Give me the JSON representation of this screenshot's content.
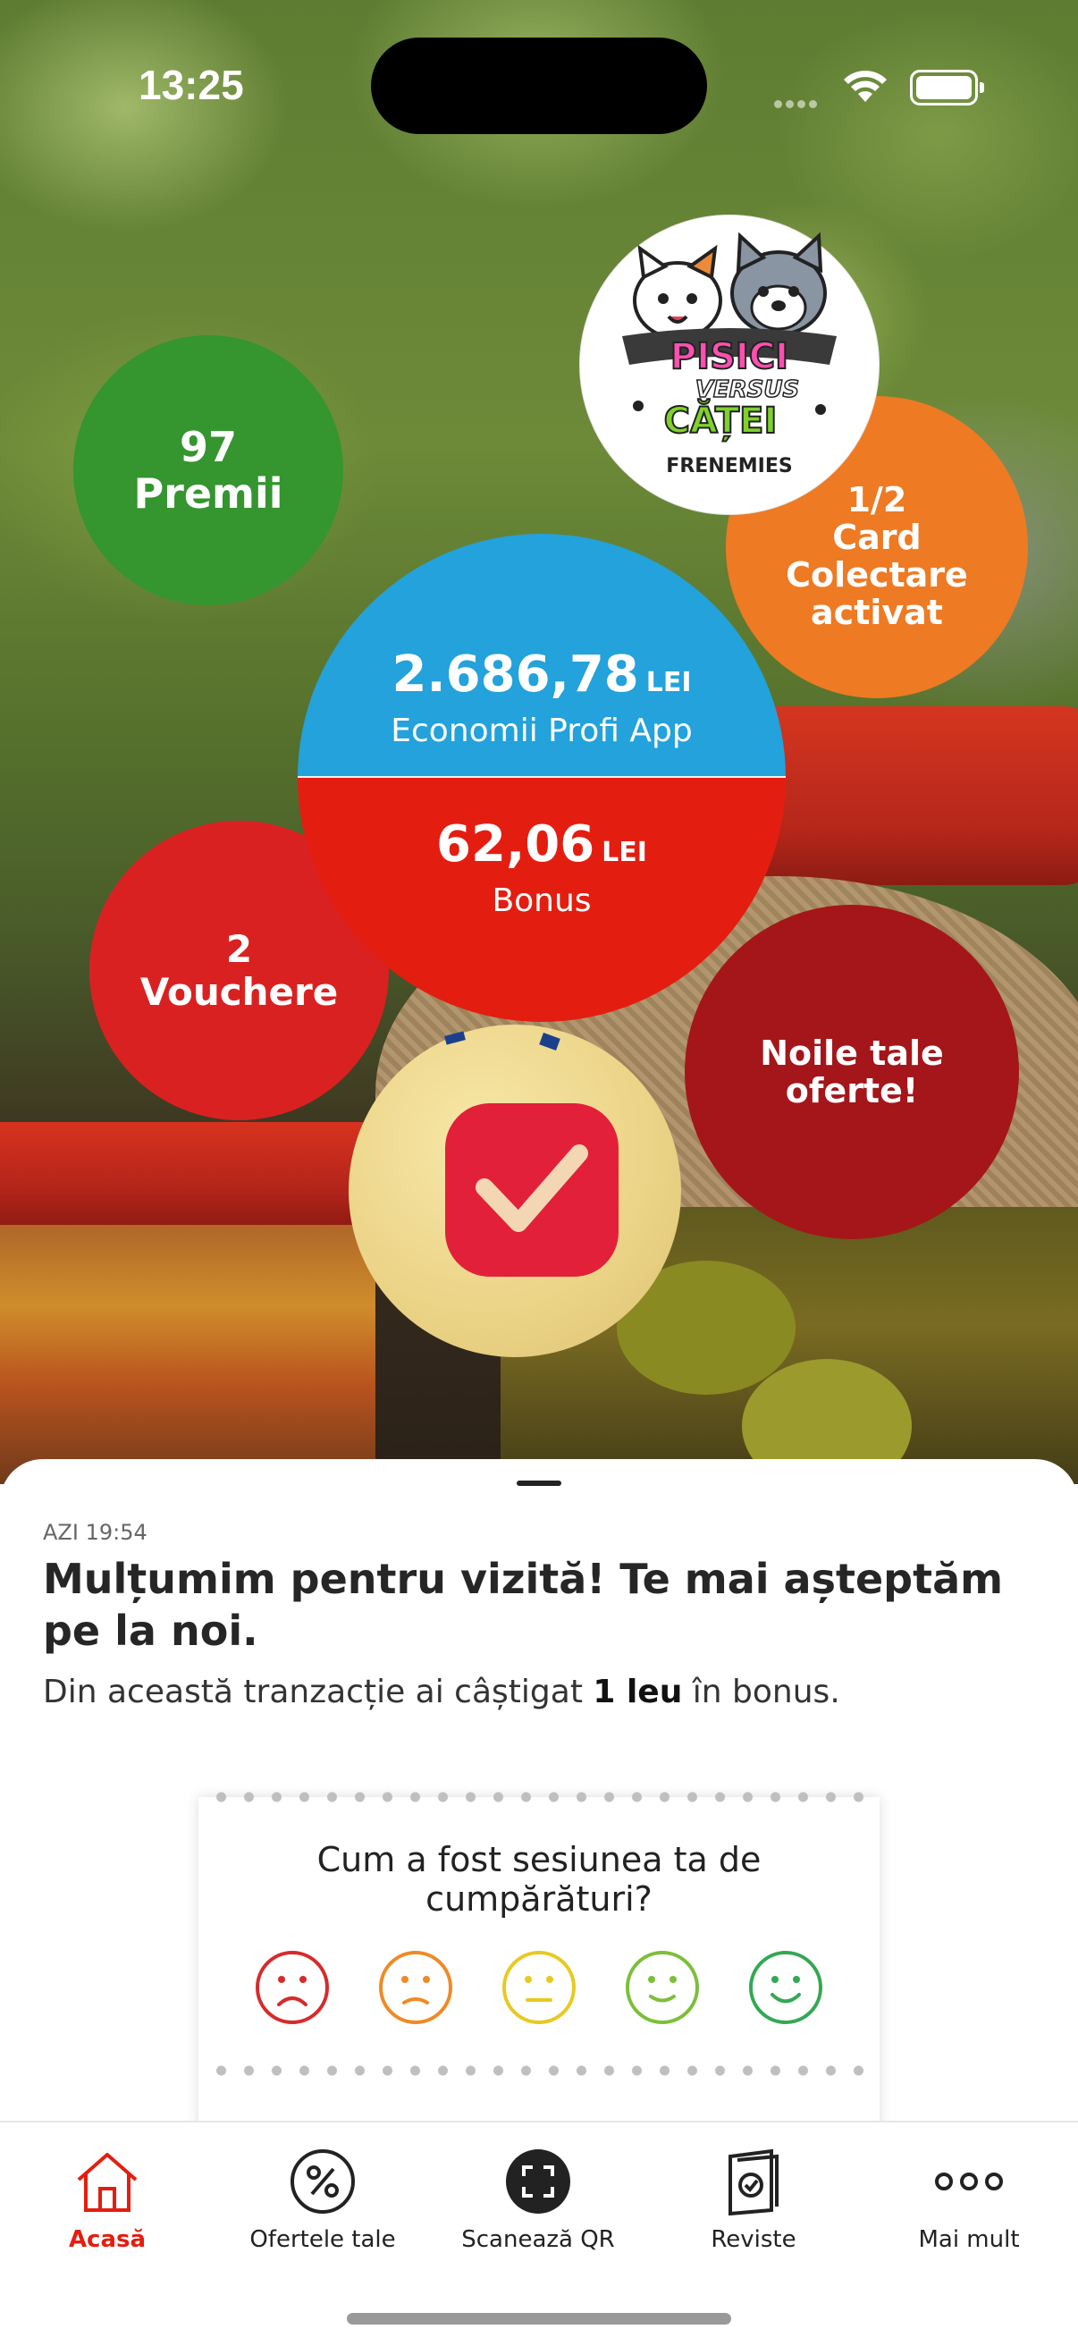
{
  "status_bar": {
    "time": "13:25"
  },
  "bubbles": {
    "premii": {
      "count": "97",
      "label": "Premii"
    },
    "card": {
      "fraction": "1/2",
      "line1": "Card",
      "line2": "Colectare",
      "line3": "activat"
    },
    "logo": {
      "line1": "PISICI",
      "line2": "VERSUS",
      "line3": "CĂȚEI",
      "line4": "FRENEMIES"
    },
    "savings": {
      "amount": "2.686,78",
      "currency": "LEI",
      "label": "Economii Profi App"
    },
    "bonus": {
      "amount": "62,06",
      "currency": "LEI",
      "label": "Bonus"
    },
    "vouchers": {
      "count": "2",
      "label": "Vouchere"
    },
    "offers": {
      "line1": "Noile tale",
      "line2": "oferte!"
    }
  },
  "message": {
    "time": "AZI 19:54",
    "title": "Mulțumim pentru vizită! Te mai așteptăm pe la noi.",
    "body_prefix": "Din această tranzacție ai câștigat ",
    "body_bold": "1 leu",
    "body_suffix": " în bonus."
  },
  "survey": {
    "question": "Cum a fost sesiunea ta de cumpărături?",
    "faces": [
      {
        "name": "very-sad",
        "color": "#d62b2b"
      },
      {
        "name": "sad",
        "color": "#ef8a25"
      },
      {
        "name": "neutral",
        "color": "#e8c920"
      },
      {
        "name": "happy",
        "color": "#7cbf3a"
      },
      {
        "name": "very-happy",
        "color": "#34a853"
      }
    ]
  },
  "tabs": [
    {
      "label": "Acasă",
      "icon": "home-icon",
      "active": true
    },
    {
      "label": "Ofertele tale",
      "icon": "percent-icon",
      "active": false
    },
    {
      "label": "Scanează QR",
      "icon": "qr-scan-icon",
      "active": false
    },
    {
      "label": "Reviste",
      "icon": "magazine-icon",
      "active": false
    },
    {
      "label": "Mai mult",
      "icon": "more-icon",
      "active": false
    }
  ],
  "colors": {
    "brand_red": "#e31e10",
    "savings_blue": "#23a2db",
    "premii_green": "#35952f",
    "card_orange": "#ee7a23"
  }
}
